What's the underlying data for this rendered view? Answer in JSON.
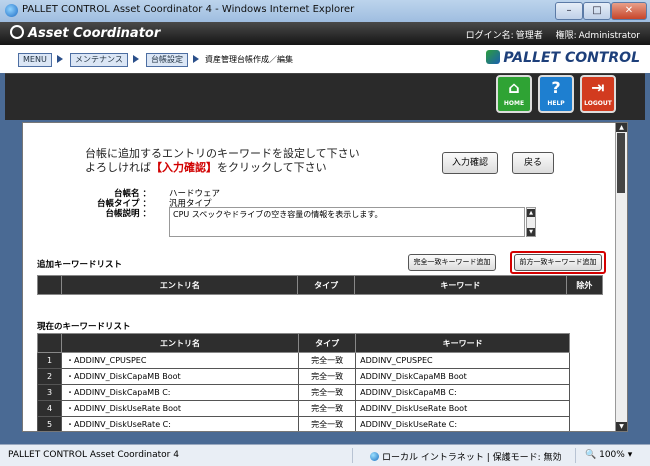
{
  "window": {
    "title": "PALLET CONTROL Asset Coordinator 4 - Windows Internet Explorer"
  },
  "header": {
    "brand": "Asset Coordinator",
    "login_label": "ログイン名:",
    "login_value": "管理者",
    "account_label": "権限:",
    "account_value": "Administrator"
  },
  "breadcrumb": {
    "items": [
      "MENU",
      "メンテナンス",
      "台帳設定"
    ],
    "current": "資産管理台帳作成／編集"
  },
  "logo": {
    "text": "PALLET CONTROL"
  },
  "toolbar": {
    "home": {
      "label": "HOME",
      "color": "#2fa334"
    },
    "help": {
      "label": "HELP",
      "color": "#1e7fd0"
    },
    "logout": {
      "label": "LOGOUT",
      "color": "#d23b1f"
    }
  },
  "instruction": {
    "line1": "台帳に追加するエントリのキーワードを設定して下さい",
    "line2_pre": "よろしければ",
    "line2_highlight": "【入力確認】",
    "line2_post": "をクリックして下さい"
  },
  "buttons": {
    "confirm": "入力確認",
    "back": "戻る",
    "add_exact": "完全一致キーワード追加",
    "add_prefix": "前方一致キーワード追加"
  },
  "ledger": {
    "name_label": "台帳名",
    "name_value": "ハードウェア",
    "type_label": "台帳タイプ",
    "type_value": "汎用タイプ",
    "desc_label": "台帳説明",
    "desc_value": "CPU スペックやドライブの空き容量の情報を表示します。"
  },
  "add_list": {
    "title": "追加キーワードリスト",
    "columns": [
      "エントリ名",
      "タイプ",
      "キーワード",
      "除外"
    ]
  },
  "current_list": {
    "title": "現在のキーワードリスト",
    "columns": [
      "エントリ名",
      "タイプ",
      "キーワード"
    ],
    "rows": [
      {
        "num": "1",
        "entry": "・ADDINV_CPUSPEC",
        "type": "完全一致",
        "keyword": "ADDINV_CPUSPEC"
      },
      {
        "num": "2",
        "entry": "・ADDINV_DiskCapaMB Boot",
        "type": "完全一致",
        "keyword": "ADDINV_DiskCapaMB Boot"
      },
      {
        "num": "3",
        "entry": "・ADDINV_DiskCapaMB C:",
        "type": "完全一致",
        "keyword": "ADDINV_DiskCapaMB C:"
      },
      {
        "num": "4",
        "entry": "・ADDINV_DiskUseRate Boot",
        "type": "完全一致",
        "keyword": "ADDINV_DiskUseRate Boot"
      },
      {
        "num": "5",
        "entry": "・ADDINV_DiskUseRate C:",
        "type": "完全一致",
        "keyword": "ADDINV_DiskUseRate C:"
      }
    ]
  },
  "status": {
    "left": "PALLET CONTROL Asset Coordinator 4",
    "zone": "ローカル イントラネット | 保護モード: 無効",
    "zoom": "100%"
  }
}
